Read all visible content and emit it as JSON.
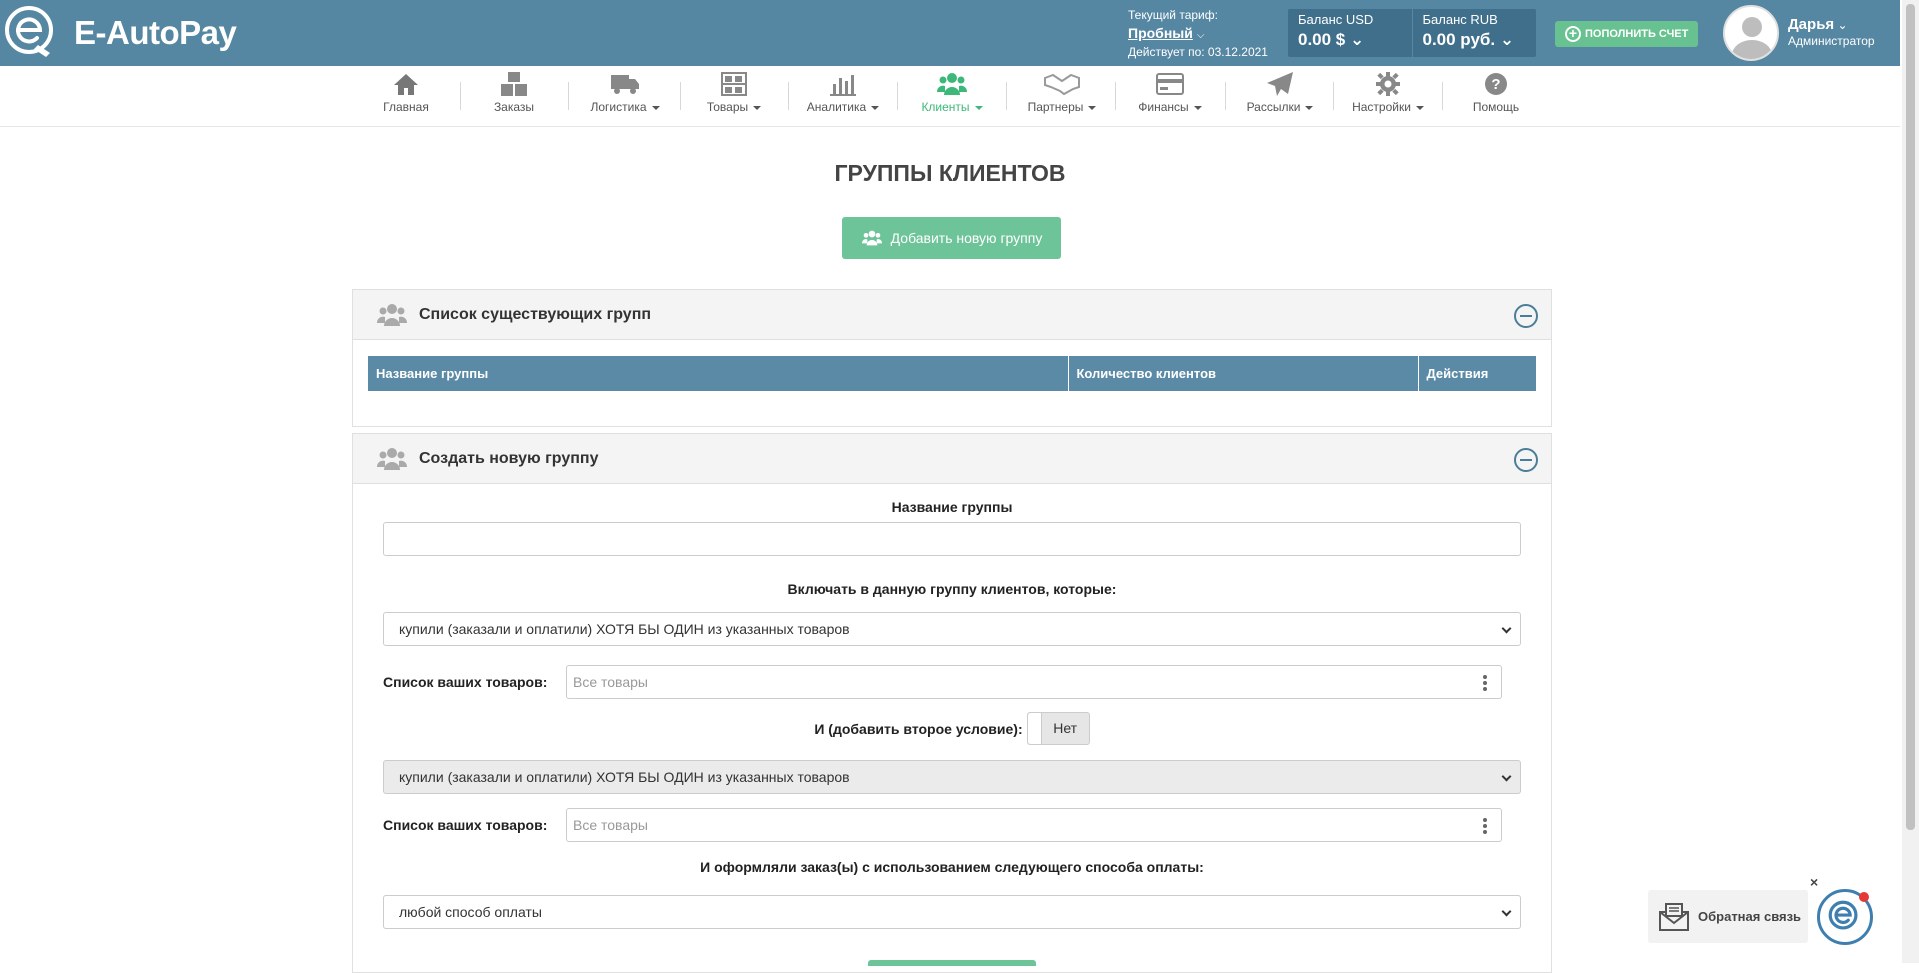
{
  "header": {
    "brand": "E-AutoPay",
    "tariff": {
      "label": "Текущий тариф:",
      "plan": "Пробный",
      "valid": "Действует по: 03.12.2021"
    },
    "balances": [
      {
        "label": "Баланс USD",
        "value": "0.00 $"
      },
      {
        "label": "Баланс RUB",
        "value": "0.00 руб."
      }
    ],
    "topup_label": "ПОПОЛНИТЬ СЧЕТ",
    "user": {
      "name": "Дарья",
      "role": "Администратор"
    },
    "colors": {
      "bar": "#5586a2",
      "accent": "#68c190"
    }
  },
  "nav": {
    "items": [
      {
        "label": "Главная",
        "icon": "home-icon",
        "dropdown": false
      },
      {
        "label": "Заказы",
        "icon": "boxes-icon",
        "dropdown": false
      },
      {
        "label": "Логистика",
        "icon": "truck-icon",
        "dropdown": true
      },
      {
        "label": "Товары",
        "icon": "shelves-icon",
        "dropdown": true
      },
      {
        "label": "Аналитика",
        "icon": "chart-icon",
        "dropdown": true
      },
      {
        "label": "Клиенты",
        "icon": "users-icon",
        "dropdown": true,
        "active": true
      },
      {
        "label": "Партнеры",
        "icon": "handshake-icon",
        "dropdown": true
      },
      {
        "label": "Финансы",
        "icon": "credit-card-icon",
        "dropdown": true
      },
      {
        "label": "Рассылки",
        "icon": "paper-plane-icon",
        "dropdown": true
      },
      {
        "label": "Настройки",
        "icon": "gear-icon",
        "dropdown": true
      },
      {
        "label": "Помощь",
        "icon": "question-icon",
        "dropdown": false
      }
    ],
    "active_color": "#3db87a"
  },
  "main": {
    "title": "ГРУППЫ КЛИЕНТОВ",
    "add_group_label": "Добавить новую группу",
    "existing_panel": {
      "title": "Список существующих групп",
      "columns": [
        "Название группы",
        "Количество клиентов",
        "Действия"
      ]
    },
    "create_panel": {
      "title": "Создать новую группу",
      "name_label": "Название группы",
      "name_value": "",
      "include_label": "Включать в данную группу клиентов, которые:",
      "condition1": "купили (заказали и оплатили) ХОТЯ БЫ ОДИН из указанных товаров",
      "products_label": "Список ваших товаров:",
      "products_placeholder": "Все товары",
      "second_condition_label": "И (добавить второе условие):",
      "second_condition_toggle": "Нет",
      "condition2": "купили (заказали и оплатили) ХОТЯ БЫ ОДИН из указанных товаров",
      "products2_label": "Список ваших товаров:",
      "products2_placeholder": "Все товары",
      "payment_label": "И оформляли заказ(ы) с использованием следующего способа оплаты:",
      "payment_value": "любой способ оплаты"
    }
  },
  "feedback": {
    "label": "Обратная связь",
    "close": "×"
  }
}
